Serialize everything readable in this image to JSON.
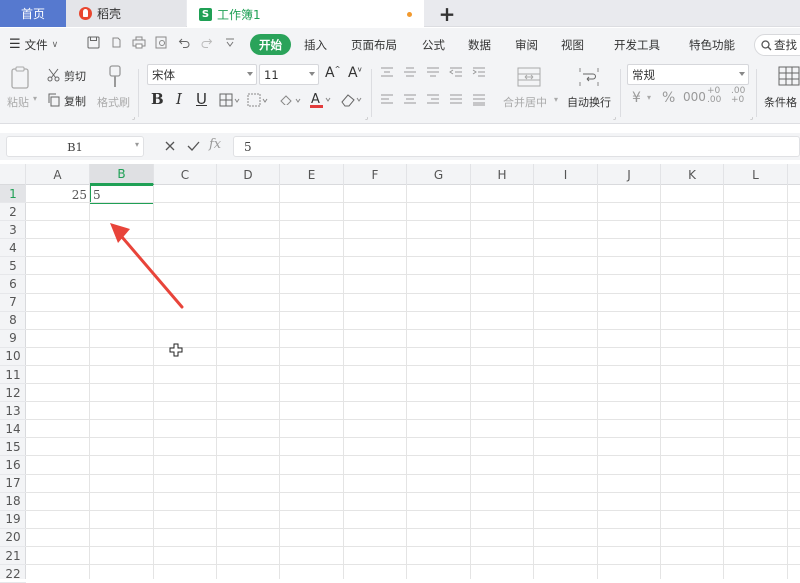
{
  "tabs": {
    "home": "首页",
    "daoke": "稻壳",
    "workbook": "工作簿1",
    "add": "+"
  },
  "menu": {
    "file": "文件",
    "start": "开始",
    "insert": "插入",
    "page_layout": "页面布局",
    "formula": "公式",
    "data": "数据",
    "review": "审阅",
    "view": "视图",
    "developer": "开发工具",
    "features": "特色功能",
    "search": "查找"
  },
  "ribbon": {
    "paste": "粘贴",
    "cut": "剪切",
    "copy": "复制",
    "format_painter": "格式刷",
    "font_name": "宋体",
    "font_size": "11",
    "merge_center": "合并居中",
    "wrap_text": "自动换行",
    "number_format": "常规",
    "cond_format": "条件格"
  },
  "formula_bar": {
    "name_box": "B1",
    "content": "5",
    "fx": "fx"
  },
  "columns": [
    "A",
    "B",
    "C",
    "D",
    "E",
    "F",
    "G",
    "H",
    "I",
    "J",
    "K",
    "L"
  ],
  "rows": [
    "1",
    "2",
    "3",
    "4",
    "5",
    "6",
    "7",
    "8",
    "9",
    "10",
    "11",
    "12",
    "13",
    "14",
    "15",
    "16",
    "17",
    "18",
    "19",
    "20",
    "21",
    "22"
  ],
  "cells": {
    "A1": "25",
    "B1": "5"
  },
  "colors": {
    "accent_green": "#1fa055",
    "home_tab": "#5679cf",
    "annotation_arrow": "#e8443a"
  }
}
